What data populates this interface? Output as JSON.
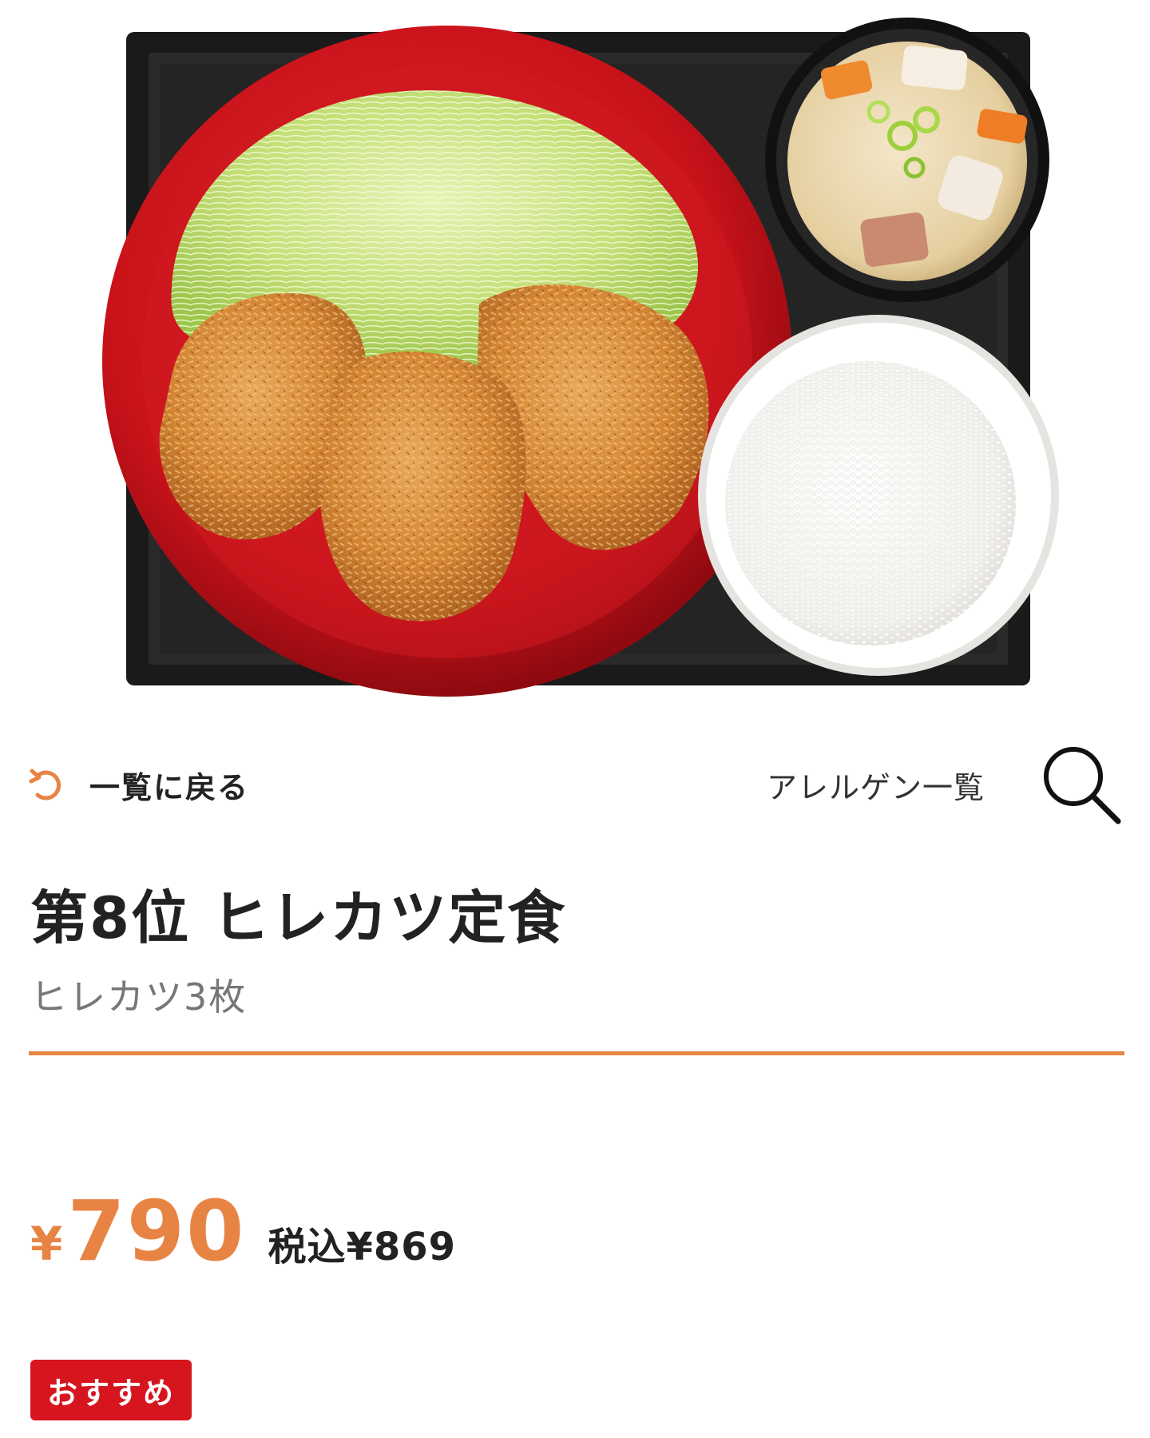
{
  "hero": {
    "image": "hirekatsu-teishoku-photo"
  },
  "nav": {
    "back_label": "一覧に戻る",
    "back_icon": "undo-arrow-icon",
    "allergen_label": "アレルゲン一覧",
    "search_icon": "search-icon"
  },
  "product": {
    "title": "第8位 ヒレカツ定食",
    "description": "ヒレカツ3枚",
    "price_symbol": "¥",
    "price": "790",
    "tax_included": "税込¥869",
    "badge": "おすすめ"
  },
  "colors": {
    "accent": "#e88443",
    "badge": "#d7151f",
    "text": "#222222",
    "muted": "#777777"
  }
}
